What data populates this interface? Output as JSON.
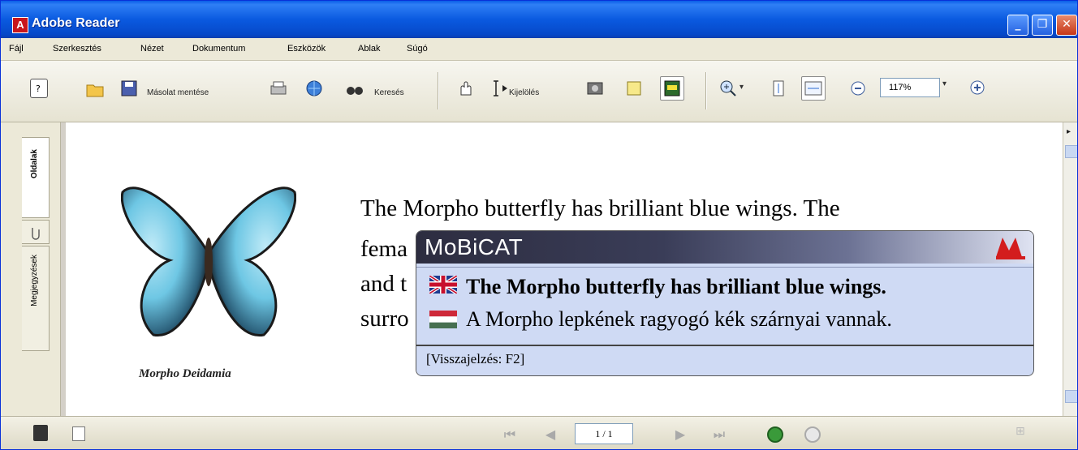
{
  "window": {
    "title": "Adobe Reader"
  },
  "menu": [
    "Fájl",
    "Szerkesztés",
    "Nézet",
    "Dokumentum",
    "Eszközök",
    "Ablak",
    "Súgó"
  ],
  "toolbar": {
    "save_copy_label": "Másolat mentése",
    "search_label": "Keresés",
    "select_label": "Kijelölés",
    "zoom_value": "117%"
  },
  "nav_tabs": [
    "Oldalak",
    "Megjegyzések"
  ],
  "document": {
    "caption": "Morpho Deidamia",
    "lines": [
      "The Morpho butterfly has brilliant blue wings. The",
      "fema",
      "and t",
      "surro"
    ]
  },
  "popup": {
    "title": "MoBiCAT",
    "source_text": "The Morpho butterfly has brilliant blue wings.",
    "target_text": "A Morpho lepkének ragyogó kék szárnyai vannak.",
    "footer": "[Visszajelzés: F2]"
  },
  "statusbar": {
    "page_indicator": "1 / 1"
  },
  "colors": {
    "title_bar": "#0a5ae0",
    "popup_bg": "#cfdaf4",
    "accent_green": "#3a9a3a"
  }
}
